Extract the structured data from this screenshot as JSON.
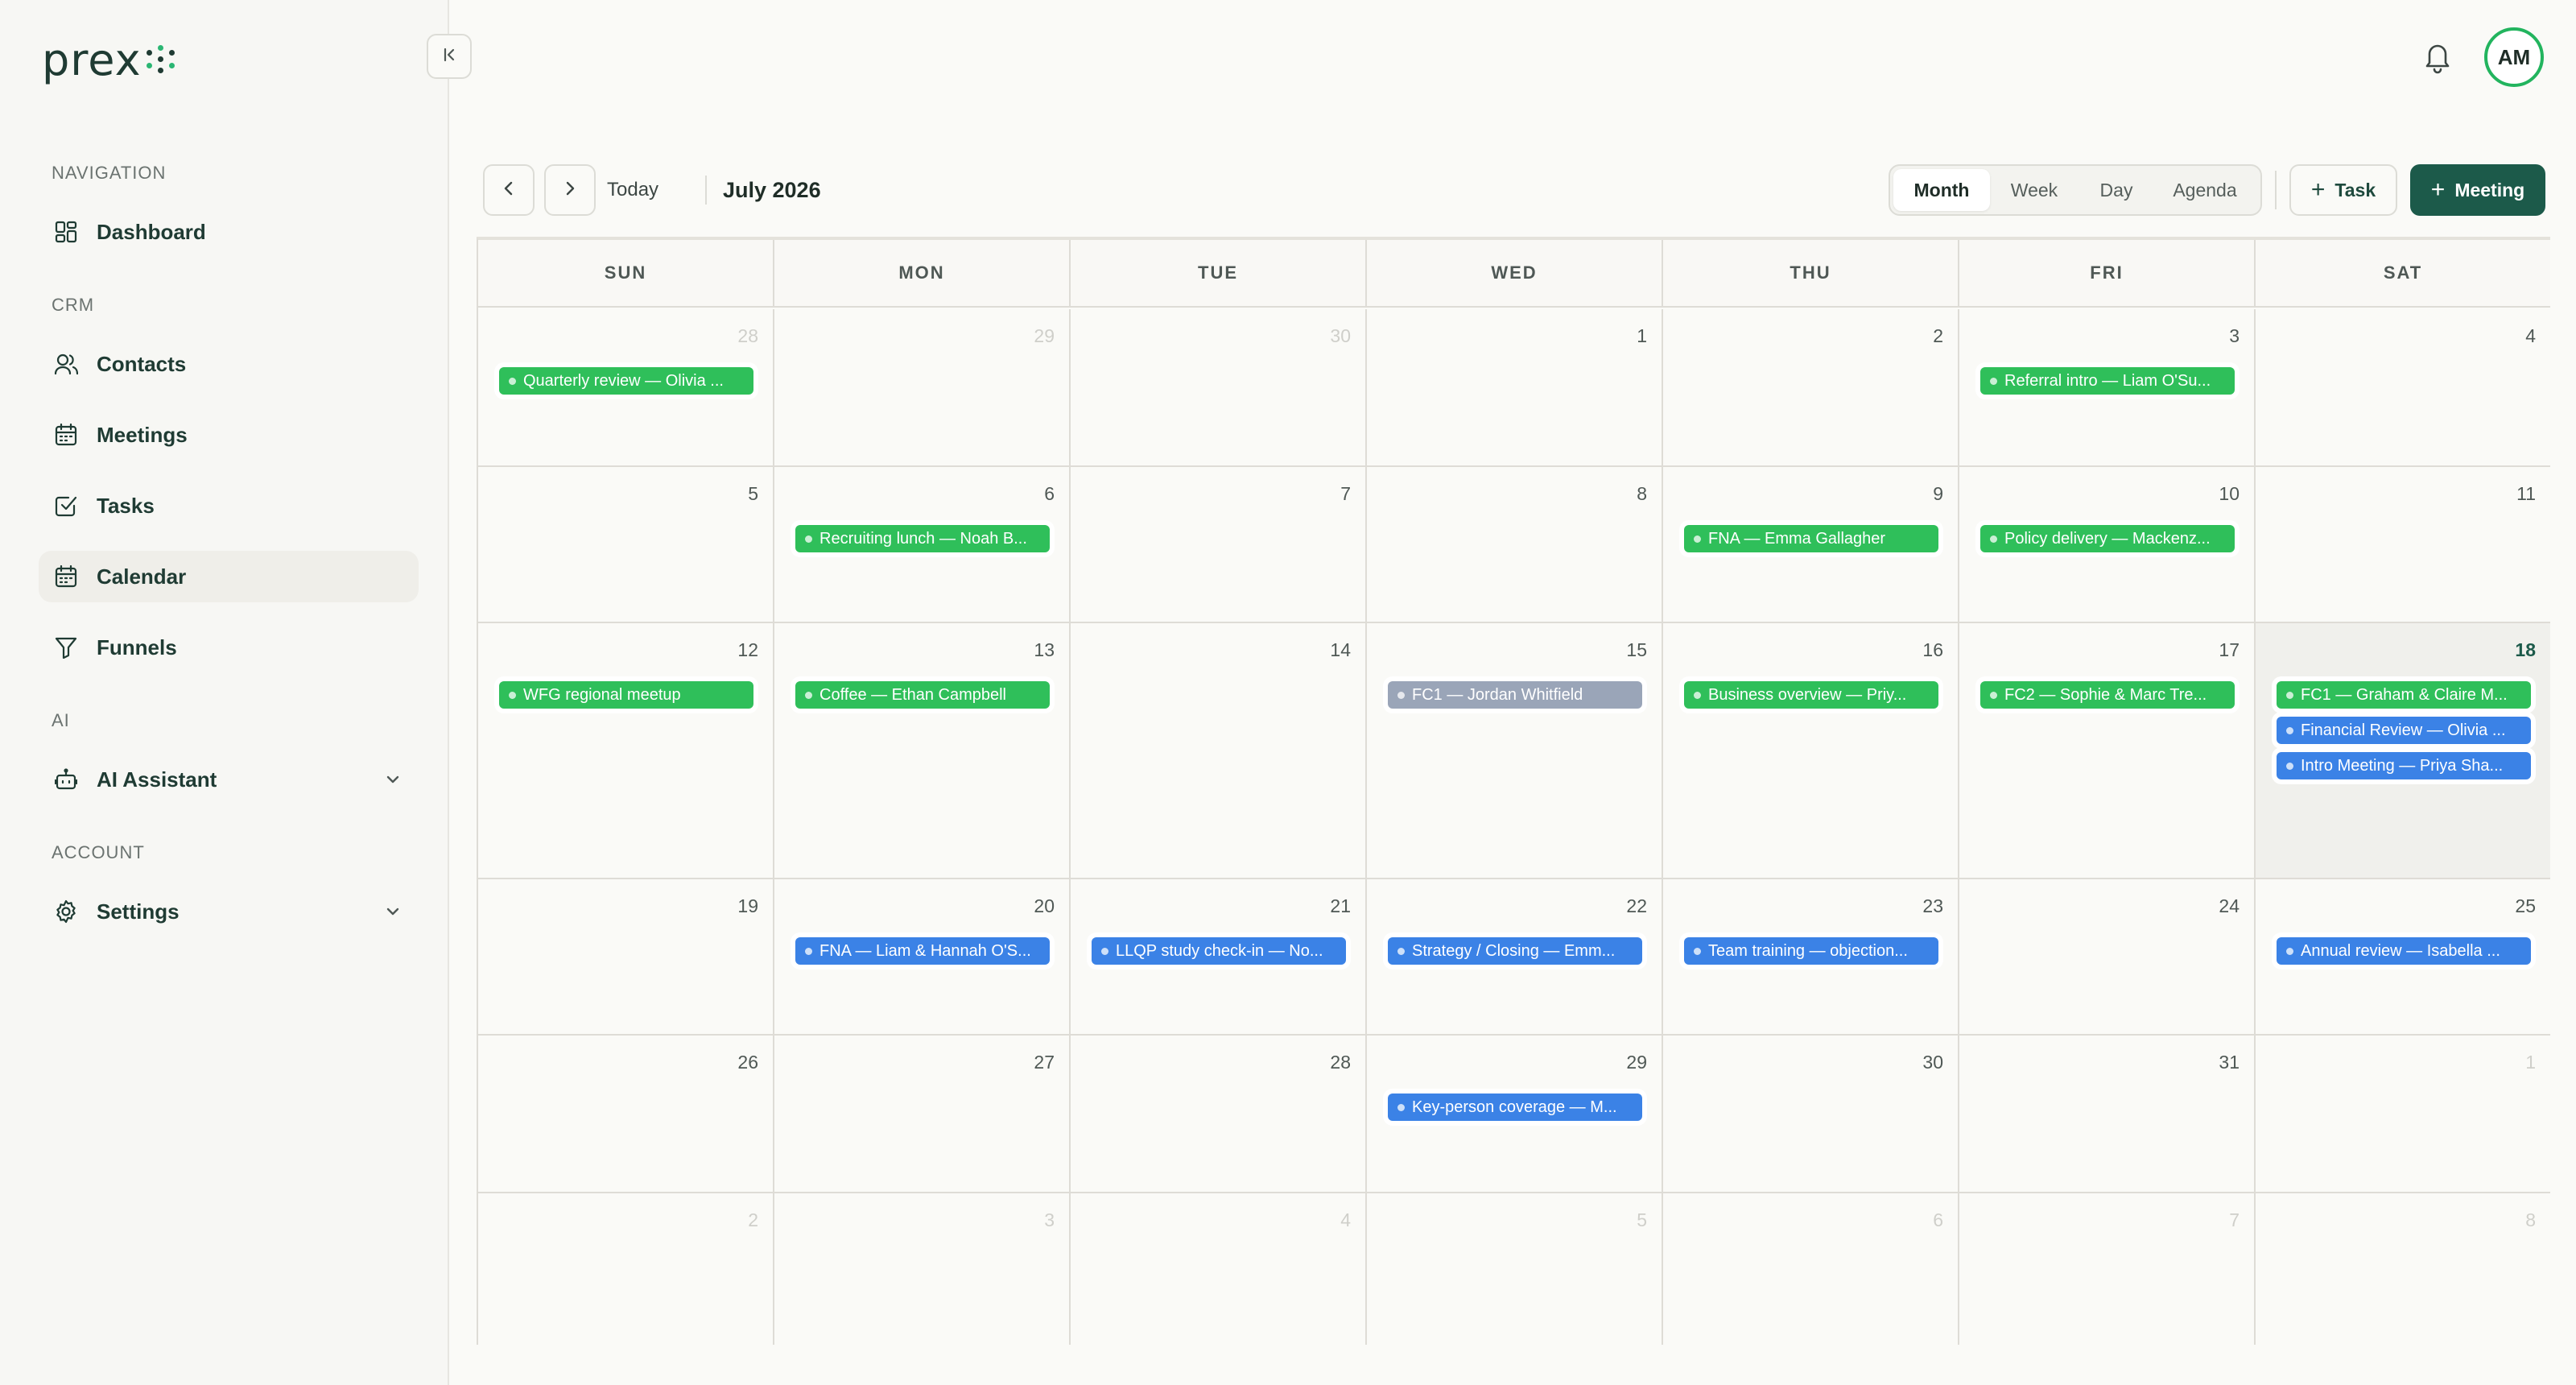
{
  "app": {
    "logo_text": "prex"
  },
  "sidebar": {
    "sections": [
      {
        "label": "NAVIGATION",
        "items": [
          {
            "label": "Dashboard",
            "icon": "grid-icon",
            "active": false
          }
        ]
      },
      {
        "label": "CRM",
        "items": [
          {
            "label": "Contacts",
            "icon": "users-icon",
            "active": false
          },
          {
            "label": "Meetings",
            "icon": "calendar-icon",
            "active": false
          },
          {
            "label": "Tasks",
            "icon": "checkbox-icon",
            "active": false
          },
          {
            "label": "Calendar",
            "icon": "calendar-icon",
            "active": true
          },
          {
            "label": "Funnels",
            "icon": "filter-icon",
            "active": false
          }
        ]
      },
      {
        "label": "AI",
        "items": [
          {
            "label": "AI Assistant",
            "icon": "robot-icon",
            "active": false,
            "expandable": true
          }
        ]
      },
      {
        "label": "ACCOUNT",
        "items": [
          {
            "label": "Settings",
            "icon": "gear-icon",
            "active": false,
            "expandable": true
          }
        ]
      }
    ]
  },
  "topbar": {
    "avatar_initials": "AM"
  },
  "toolbar": {
    "today_label": "Today",
    "month_title": "July 2026",
    "views": [
      "Month",
      "Week",
      "Day",
      "Agenda"
    ],
    "active_view": "Month",
    "task_label": "Task",
    "meeting_label": "Meeting"
  },
  "calendar": {
    "weekdays": [
      "SUN",
      "MON",
      "TUE",
      "WED",
      "THU",
      "FRI",
      "SAT"
    ],
    "today": 18,
    "weeks": [
      [
        {
          "day": "28",
          "other": true,
          "events": [
            {
              "title": "Quarterly review — Olivia ...",
              "color": "green"
            }
          ]
        },
        {
          "day": "29",
          "other": true,
          "events": []
        },
        {
          "day": "30",
          "other": true,
          "events": []
        },
        {
          "day": "1",
          "events": []
        },
        {
          "day": "2",
          "events": []
        },
        {
          "day": "3",
          "events": [
            {
              "title": "Referral intro — Liam O'Su...",
              "color": "green"
            }
          ]
        },
        {
          "day": "4",
          "events": []
        }
      ],
      [
        {
          "day": "5",
          "events": []
        },
        {
          "day": "6",
          "events": [
            {
              "title": "Recruiting lunch — Noah B...",
              "color": "green"
            }
          ]
        },
        {
          "day": "7",
          "events": []
        },
        {
          "day": "8",
          "events": []
        },
        {
          "day": "9",
          "events": [
            {
              "title": "FNA — Emma Gallagher",
              "color": "green"
            }
          ]
        },
        {
          "day": "10",
          "events": [
            {
              "title": "Policy delivery — Mackenz...",
              "color": "green"
            }
          ]
        },
        {
          "day": "11",
          "events": []
        }
      ],
      [
        {
          "day": "12",
          "events": [
            {
              "title": "WFG regional meetup",
              "color": "green"
            }
          ]
        },
        {
          "day": "13",
          "events": [
            {
              "title": "Coffee — Ethan Campbell",
              "color": "green"
            }
          ]
        },
        {
          "day": "14",
          "events": []
        },
        {
          "day": "15",
          "events": [
            {
              "title": "FC1 — Jordan Whitfield",
              "color": "gray"
            }
          ]
        },
        {
          "day": "16",
          "events": [
            {
              "title": "Business overview — Priy...",
              "color": "green"
            }
          ]
        },
        {
          "day": "17",
          "events": [
            {
              "title": "FC2 — Sophie & Marc Tre...",
              "color": "green"
            }
          ]
        },
        {
          "day": "18",
          "today": true,
          "events": [
            {
              "title": "FC1 — Graham & Claire M...",
              "color": "green"
            },
            {
              "title": "Financial Review — Olivia ...",
              "color": "blue"
            },
            {
              "title": "Intro Meeting — Priya Sha...",
              "color": "blue"
            }
          ]
        }
      ],
      [
        {
          "day": "19",
          "events": []
        },
        {
          "day": "20",
          "events": [
            {
              "title": "FNA — Liam & Hannah O'S...",
              "color": "blue"
            }
          ]
        },
        {
          "day": "21",
          "events": [
            {
              "title": "LLQP study check-in — No...",
              "color": "blue"
            }
          ]
        },
        {
          "day": "22",
          "events": [
            {
              "title": "Strategy / Closing — Emm...",
              "color": "blue"
            }
          ]
        },
        {
          "day": "23",
          "events": [
            {
              "title": "Team training — objection...",
              "color": "blue"
            }
          ]
        },
        {
          "day": "24",
          "events": []
        },
        {
          "day": "25",
          "events": [
            {
              "title": "Annual review — Isabella ...",
              "color": "blue"
            }
          ]
        }
      ],
      [
        {
          "day": "26",
          "events": []
        },
        {
          "day": "27",
          "events": []
        },
        {
          "day": "28",
          "events": []
        },
        {
          "day": "29",
          "events": [
            {
              "title": "Key-person coverage — M...",
              "color": "blue"
            }
          ]
        },
        {
          "day": "30",
          "events": []
        },
        {
          "day": "31",
          "events": []
        },
        {
          "day": "1",
          "other": true,
          "events": []
        }
      ],
      [
        {
          "day": "2",
          "other": true,
          "events": []
        },
        {
          "day": "3",
          "other": true,
          "events": []
        },
        {
          "day": "4",
          "other": true,
          "events": []
        },
        {
          "day": "5",
          "other": true,
          "events": []
        },
        {
          "day": "6",
          "other": true,
          "events": []
        },
        {
          "day": "7",
          "other": true,
          "events": []
        },
        {
          "day": "8",
          "other": true,
          "events": []
        }
      ]
    ]
  }
}
